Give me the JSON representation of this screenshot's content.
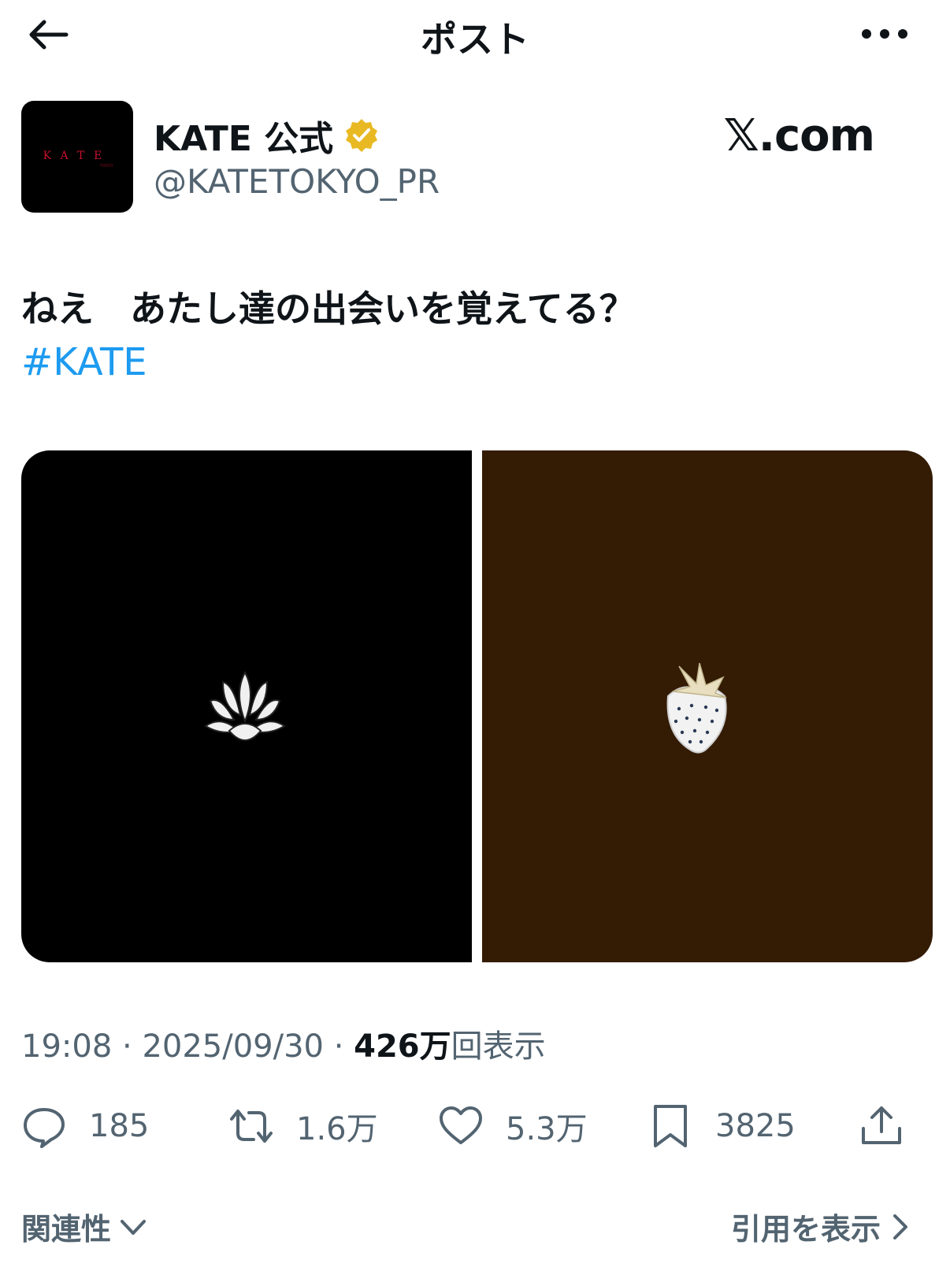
{
  "header": {
    "title": "ポスト"
  },
  "author": {
    "name": "KATE 公式",
    "handle": "@KATETOKYO_PR",
    "avatar_text": "KATE",
    "verified_color": "#e8b923"
  },
  "watermark": "𝕏.com",
  "post": {
    "text": "ねえ　あたし達の出会いを覚えてる？",
    "hashtag": "#KATE"
  },
  "media": {
    "left": {
      "icon": "lotus-flower-icon",
      "bg": "#000000"
    },
    "right": {
      "icon": "white-strawberry-icon",
      "bg": "#341b04"
    }
  },
  "meta": {
    "time": "19:08",
    "date": "2025/09/30",
    "views_count": "426万",
    "views_label": "回表示"
  },
  "actions": {
    "replies": "185",
    "reposts": "1.6万",
    "likes": "5.3万",
    "bookmarks": "3825"
  },
  "footer": {
    "related": "関連性",
    "quotes": "引用を表示"
  },
  "colors": {
    "link": "#1d9bf0",
    "secondary": "#536471"
  }
}
